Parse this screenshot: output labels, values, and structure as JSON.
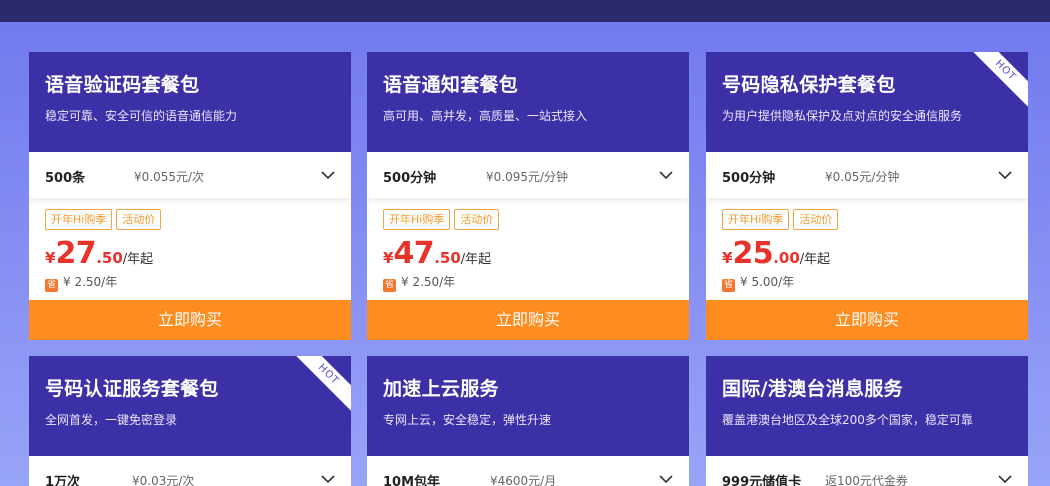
{
  "cards": [
    {
      "title": "语音验证码套餐包",
      "subtitle": "稳定可靠、安全可信的语音通信能力",
      "hot": "",
      "quantity": "500条",
      "unit_price": "¥0.055元/次",
      "tags": [
        "开年Hi购季",
        "活动价"
      ],
      "price_symbol": "¥",
      "price_int": "27",
      "price_dec": ".50",
      "price_suffix": "/年起",
      "save_badge": "省",
      "save_text": "¥ 2.50/年",
      "buy_label": "立即购买"
    },
    {
      "title": "语音通知套餐包",
      "subtitle": "高可用、高并发，高质量、一站式接入",
      "hot": "",
      "quantity": "500分钟",
      "unit_price": "¥0.095元/分钟",
      "tags": [
        "开年Hi购季",
        "活动价"
      ],
      "price_symbol": "¥",
      "price_int": "47",
      "price_dec": ".50",
      "price_suffix": "/年起",
      "save_badge": "省",
      "save_text": "¥ 2.50/年",
      "buy_label": "立即购买"
    },
    {
      "title": "号码隐私保护套餐包",
      "subtitle": "为用户提供隐私保护及点对点的安全通信服务",
      "hot": "HOT",
      "quantity": "500分钟",
      "unit_price": "¥0.05元/分钟",
      "tags": [
        "开年Hi购季",
        "活动价"
      ],
      "price_symbol": "¥",
      "price_int": "25",
      "price_dec": ".00",
      "price_suffix": "/年起",
      "save_badge": "省",
      "save_text": "¥ 5.00/年",
      "buy_label": "立即购买"
    },
    {
      "title": "号码认证服务套餐包",
      "subtitle": "全网首发，一键免密登录",
      "hot": "HOT",
      "quantity": "1万次",
      "unit_price": "¥0.03元/次"
    },
    {
      "title": "加速上云服务",
      "subtitle": "专网上云，安全稳定，弹性升速",
      "hot": "",
      "quantity": "10M包年",
      "unit_price": "¥4600元/月"
    },
    {
      "title": "国际/港澳台消息服务",
      "subtitle": "覆盖港澳台地区及全球200多个国家，稳定可靠",
      "hot": "",
      "quantity": "999元储值卡",
      "unit_price": "返100元代金券"
    }
  ],
  "colors": {
    "header": "#3b30a6",
    "button": "#ff8c1f",
    "price": "#e8332d",
    "tag": "#f29a2e",
    "topbar": "#2b2a6d"
  }
}
